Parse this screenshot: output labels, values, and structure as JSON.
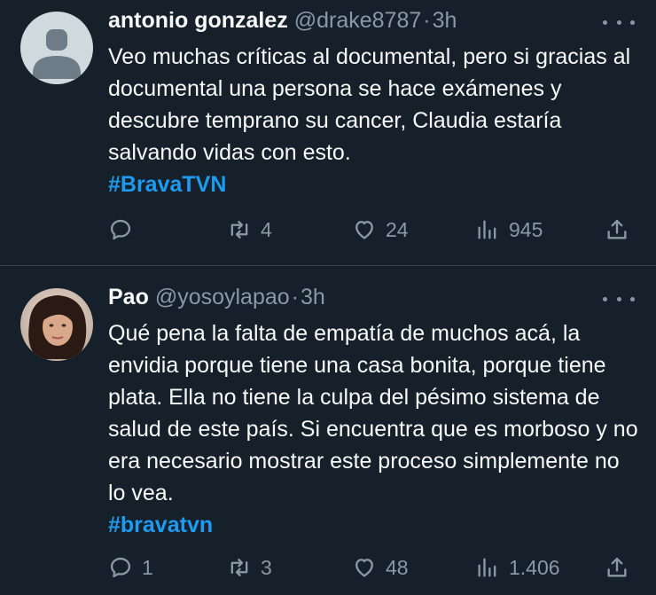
{
  "tweets": [
    {
      "name": "antonio gonzalez",
      "handle": "@drake8787",
      "separator": "·",
      "time": "3h",
      "text": "Veo muchas críticas al documental, pero si gracias al documental una persona se hace exámenes y descubre temprano su cancer, Claudia estaría salvando vidas con esto.",
      "hashtag": "#BravaTVN",
      "replies": "",
      "retweets": "4",
      "likes": "24",
      "views": "945",
      "avatar": "default-avatar"
    },
    {
      "name": "Pao",
      "handle": "@yosoylapao",
      "separator": "·",
      "time": "3h",
      "text": "Qué pena la falta de empatía de muchos acá, la envidia porque tiene una casa bonita, porque tiene plata. Ella no tiene la culpa del pésimo sistema de salud de este país. Si encuentra que es morboso y no era necesario mostrar este proceso simplemente no lo vea.",
      "hashtag": "#bravatvn",
      "replies": "1",
      "retweets": "3",
      "likes": "48",
      "views": "1.406",
      "avatar": "photo-avatar"
    }
  ],
  "icons": {
    "reply": "reply-icon",
    "retweet": "retweet-icon",
    "like": "heart-icon",
    "views": "views-icon",
    "share": "share-icon",
    "more": "more-icon"
  },
  "colors": {
    "background": "#15202b",
    "text": "#f7f9f9",
    "muted": "#8b98a5",
    "accent": "#1d9bf0",
    "divider": "#38444d"
  }
}
